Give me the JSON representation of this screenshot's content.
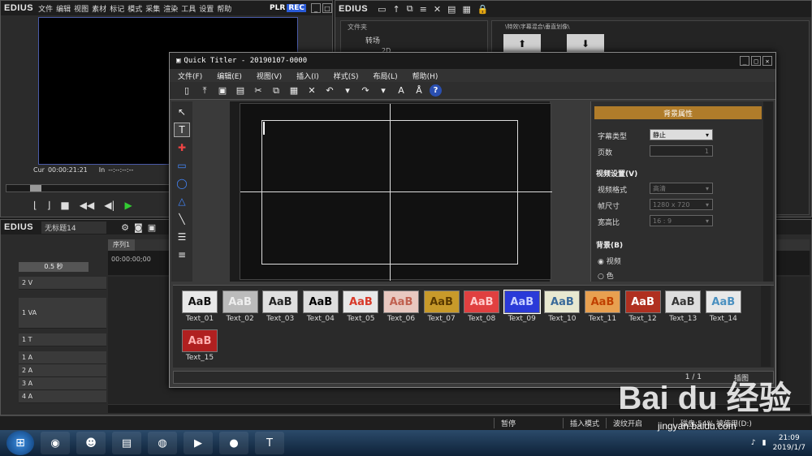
{
  "player": {
    "logo": "EDIUS",
    "menu": [
      "文件",
      "编辑",
      "视图",
      "素材",
      "标记",
      "模式",
      "采集",
      "渲染",
      "工具",
      "设置",
      "帮助"
    ],
    "plr": "PLR",
    "rec": "REC",
    "cur_label": "Cur",
    "cur_value": "00:00:21:21",
    "in_label": "In",
    "in_value": "--:--:--:--"
  },
  "bin": {
    "logo": "EDIUS",
    "folder_header": "文件夹",
    "folder_item": "转场",
    "folder_sub": "2D",
    "path": "\\特效\\字幕混合\\垂直划像\\"
  },
  "timeline": {
    "logo": "EDIUS",
    "project_name": "无标题14",
    "tab": "序列1",
    "zoom": "0.5 秒",
    "ruler_time": "00:00:00;00",
    "tracks": [
      "2 V",
      "1 VA",
      "1 T",
      "1 A",
      "2 A",
      "3 A",
      "4 A"
    ]
  },
  "status_bar": {
    "pause": "暂停",
    "insert_mode": "插入模式",
    "ripple": "波纹开启",
    "disk": "磁盘:54% 被使用(D:)"
  },
  "taskbar": {
    "time": "21:09",
    "date": "2019/1/7"
  },
  "quick_titler": {
    "title": "Quick Titler - 20190107-0000",
    "menu": [
      "文件(F)",
      "编辑(E)",
      "视图(V)",
      "插入(I)",
      "样式(S)",
      "布局(L)",
      "帮助(H)"
    ],
    "help_label": "?",
    "props": {
      "header": "背景属性",
      "subtitle_type_label": "字幕类型",
      "subtitle_type_value": "静止",
      "pages_label": "页数",
      "pages_value": "1",
      "video_section": "视频设置(V)",
      "video_format_label": "视频格式",
      "video_format_value": "高清",
      "frame_size_label": "帧尺寸",
      "frame_size_value": "1280 x 720",
      "aspect_label": "宽高比",
      "aspect_value": "16 : 9",
      "bg_section": "背景(B)",
      "bg_video": "视频",
      "bg_color": "色"
    },
    "presets": [
      {
        "name": "Text_01",
        "bg": "#e8e8e8",
        "fg": "#111111"
      },
      {
        "name": "Text_02",
        "bg": "#bbbbbb",
        "fg": "#eeeeee"
      },
      {
        "name": "Text_03",
        "bg": "#e0e0e0",
        "fg": "#222222"
      },
      {
        "name": "Text_04",
        "bg": "#dddddd",
        "fg": "#000000"
      },
      {
        "name": "Text_05",
        "bg": "#e8e8e8",
        "fg": "#d83a2a"
      },
      {
        "name": "Text_06",
        "bg": "#e8c8c0",
        "fg": "#c06050"
      },
      {
        "name": "Text_07",
        "bg": "#c89a2a",
        "fg": "#5a3a00"
      },
      {
        "name": "Text_08",
        "bg": "#e04040",
        "fg": "#ffcccc"
      },
      {
        "name": "Text_09",
        "bg": "#2a3ad8",
        "fg": "#c8d0ff"
      },
      {
        "name": "Text_10",
        "bg": "#e8e8d0",
        "fg": "#3a6a9a"
      },
      {
        "name": "Text_11",
        "bg": "#e8a050",
        "fg": "#c04000"
      },
      {
        "name": "Text_12",
        "bg": "#b03020",
        "fg": "#ffffff"
      },
      {
        "name": "Text_13",
        "bg": "#dddddd",
        "fg": "#333333"
      },
      {
        "name": "Text_14",
        "bg": "#e8e8e8",
        "fg": "#4a90c0"
      },
      {
        "name": "Text_15",
        "bg": "#b02020",
        "fg": "#ffb0b0"
      }
    ],
    "selected_preset": "Text_09",
    "page_indicator": "1 / 1",
    "mode": "插图"
  },
  "watermark": {
    "brand": "Bai du 经验",
    "url": "jingyan.baidu.com"
  }
}
